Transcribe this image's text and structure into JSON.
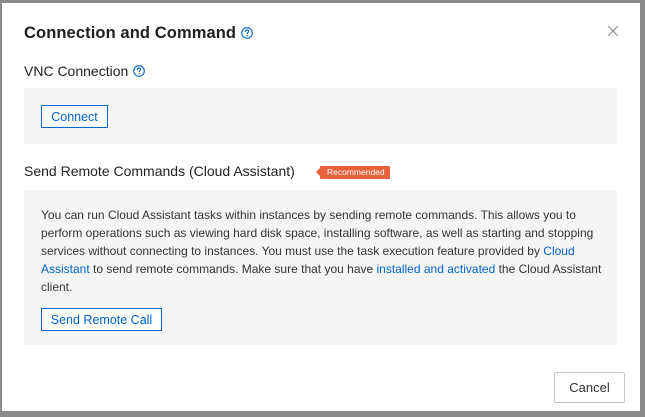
{
  "dialog": {
    "title": "Connection and Command",
    "close_icon": "close-icon",
    "help_icon": "help-circle-icon"
  },
  "vnc": {
    "title": "VNC Connection",
    "connect_label": "Connect"
  },
  "remote_commands": {
    "title": "Send Remote Commands (Cloud Assistant)",
    "badge": "Recommended",
    "description_part1": "You can run Cloud Assistant tasks within instances by sending remote commands. This allows you to perform operations such as viewing hard disk space, installing software, as well as starting and stopping services without connecting to instances. You must use the task execution feature provided by ",
    "link_cloud_assistant": "Cloud Assistant",
    "description_part2": " to send remote commands. Make sure that you have ",
    "link_installed": "installed and activated",
    "description_part3": " the Cloud Assistant client.",
    "send_label": "Send Remote Call"
  },
  "footer": {
    "cancel_label": "Cancel"
  },
  "colors": {
    "accent": "#0064c8",
    "badge": "#e8603c",
    "panel": "#f5f5f5"
  }
}
